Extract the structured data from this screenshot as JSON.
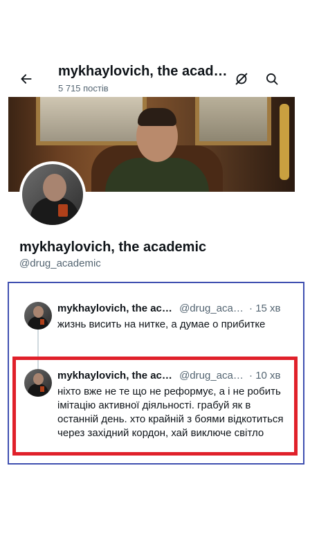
{
  "header": {
    "title": "mykhaylovich, the acad…",
    "post_count": "5 715 постів"
  },
  "profile": {
    "name": "mykhaylovich, the academic",
    "handle": "@drug_academic"
  },
  "tweets": [
    {
      "name": "mykhaylovich, the ac…",
      "handle": "@drug_aca…",
      "time": "· 15 хв",
      "text": "жизнь висить на нитке, а думае о прибитке"
    },
    {
      "name": "mykhaylovich, the ac…",
      "handle": "@drug_aca…",
      "time": "· 10 хв",
      "text": "ніхто вже не те що не реформує, а і не робить імітацію активної діяльності. грабуй як в останній день. хто крайній з боями відкотиться через західний кордон, хай виключе світло"
    }
  ],
  "colors": {
    "thread_outline": "#3f4fb0",
    "highlight_outline": "#e0202a",
    "secondary_text": "#536471"
  },
  "icons": {
    "back": "arrow-left-icon",
    "grok": "grok-icon",
    "search": "search-icon"
  }
}
